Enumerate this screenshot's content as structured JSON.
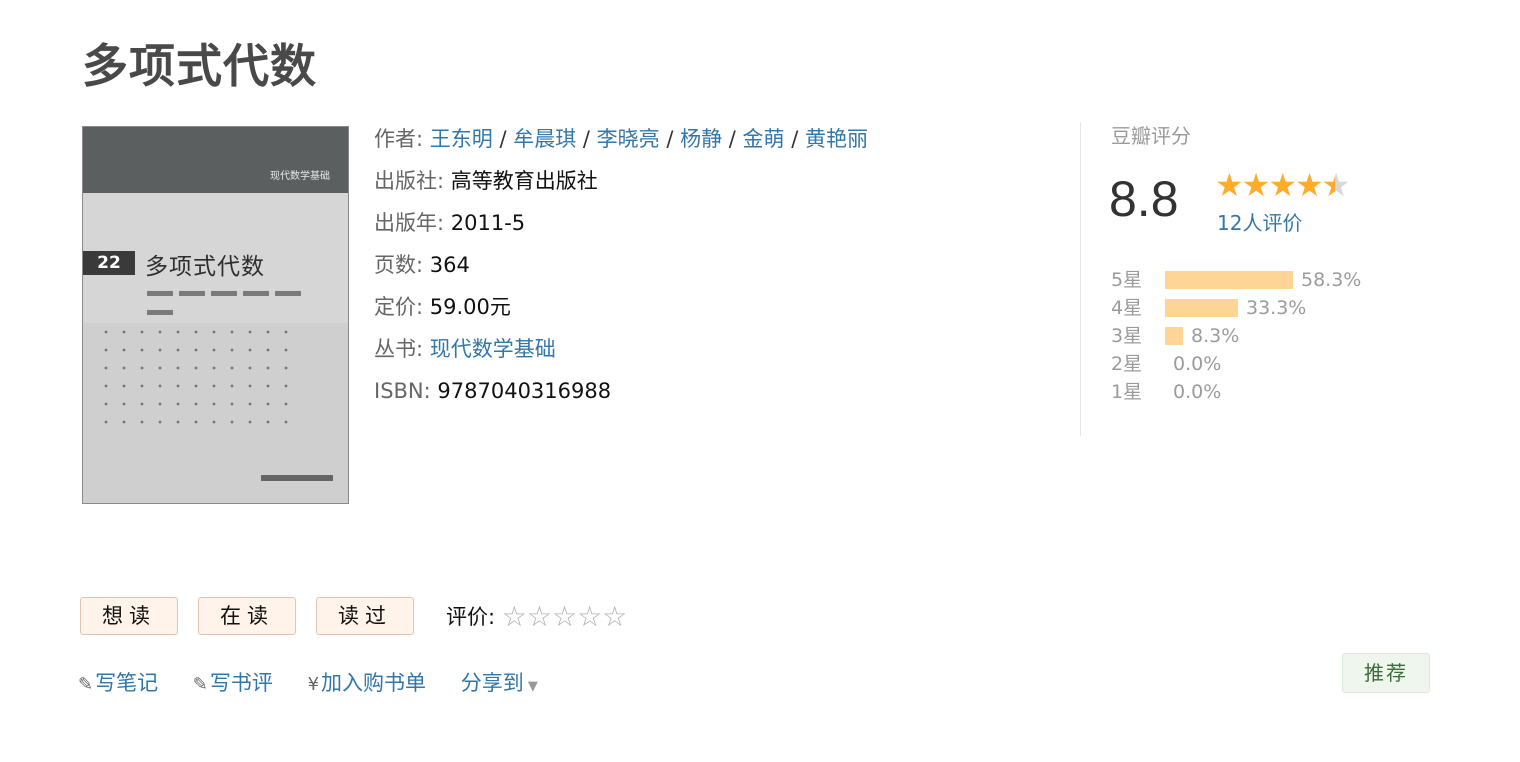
{
  "book": {
    "title": "多项式代数",
    "cover": {
      "series": "现代数学基础",
      "number": "22",
      "title": "多项式代数"
    }
  },
  "info": {
    "author_label": "作者:",
    "authors": [
      "王东明",
      "牟晨琪",
      "李晓亮",
      "杨静",
      "金萌",
      "黄艳丽"
    ],
    "separator": " / ",
    "publisher_label": "出版社:",
    "publisher": "高等教育出版社",
    "year_label": "出版年:",
    "year": "2011-5",
    "pages_label": "页数:",
    "pages": "364",
    "price_label": "定价:",
    "price": "59.00元",
    "series_label": "丛书:",
    "series": "现代数学基础",
    "isbn_label": "ISBN:",
    "isbn": "9787040316988"
  },
  "rating": {
    "label": "豆瓣评分",
    "score": "8.8",
    "stars_value": 4.5,
    "count": "12人评价",
    "distribution": [
      {
        "label": "5星",
        "percent": "58.3%",
        "value": 58.3
      },
      {
        "label": "4星",
        "percent": "33.3%",
        "value": 33.3
      },
      {
        "label": "3星",
        "percent": "8.3%",
        "value": 8.3
      },
      {
        "label": "2星",
        "percent": "0.0%",
        "value": 0.0
      },
      {
        "label": "1星",
        "percent": "0.0%",
        "value": 0.0
      }
    ]
  },
  "actions": {
    "want_read": "想读",
    "reading": "在读",
    "read": "读过",
    "my_rating_label": "评价:",
    "my_rating_stars": "☆☆☆☆☆"
  },
  "links": {
    "write_note": "写笔记",
    "write_review": "写书评",
    "add_cart": "加入购书单",
    "share": "分享到",
    "recommend": "推荐"
  },
  "colors": {
    "link": "#3377aa",
    "star": "#ffac2d",
    "bar": "#ffd596",
    "button_bg": "#fff3ea",
    "recommend_bg": "#eef6ee"
  }
}
